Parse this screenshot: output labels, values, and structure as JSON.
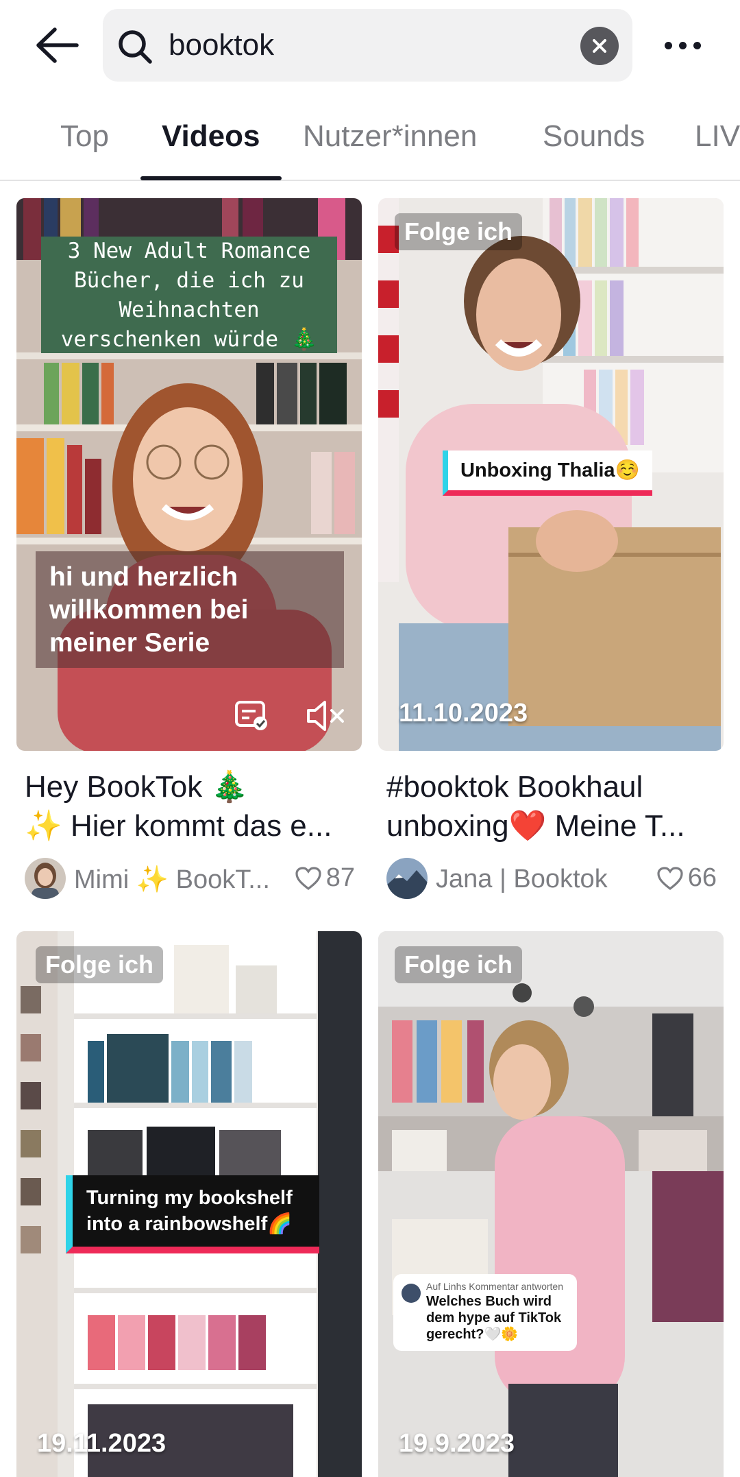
{
  "search": {
    "query": "booktok"
  },
  "tabs": [
    {
      "label": "Top"
    },
    {
      "label": "Videos"
    },
    {
      "label": "Nutzer*innen"
    },
    {
      "label": "Sounds"
    },
    {
      "label": "LIV"
    }
  ],
  "active_tab": "Videos",
  "videos": [
    {
      "overlay_text": "3 New Adult Romance\nBücher, die ich zu\nWeihnachten\nverschenken würde 🎄",
      "caption_overlay": "hi und herzlich willkommen bei meiner Serie",
      "title_line1": "Hey BookTok 🎄",
      "title_line2": "✨ Hier kommt das e...",
      "author": "Mimi ✨ BookT...",
      "likes": "87"
    },
    {
      "badge": "Folge ich",
      "label": "Unboxing Thalia☺️",
      "date": "11.10.2023",
      "title_line1": "#booktok Bookhaul",
      "title_line2": "unboxing❤️ Meine T...",
      "author": "Jana | Booktok",
      "likes": "66"
    },
    {
      "badge": "Folge ich",
      "label_line1": "Turning my bookshelf",
      "label_line2": "into a rainbowshelf🌈",
      "date": "19.11.2023"
    },
    {
      "badge": "Folge ich",
      "reply_head": "Auf Linhs Kommentar antworten",
      "reply_body": "Welches Buch wird dem hype auf TikTok gerecht?🤍🌼",
      "date": "19.9.2023"
    }
  ],
  "colors": {
    "text_primary": "#161823",
    "text_secondary": "#7c7d82",
    "search_bg": "#f1f1f2",
    "label_cyan": "#2fd3e8",
    "label_red": "#ee2a58",
    "overlay_green": "#3f6b4f"
  },
  "icons": {
    "back": "arrow-left-icon",
    "search": "magnifier-icon",
    "clear": "close-circle-icon",
    "more": "ellipsis-icon",
    "likes": "heart-outline-icon",
    "captions": "captions-icon",
    "mute": "muted-speaker-icon"
  }
}
